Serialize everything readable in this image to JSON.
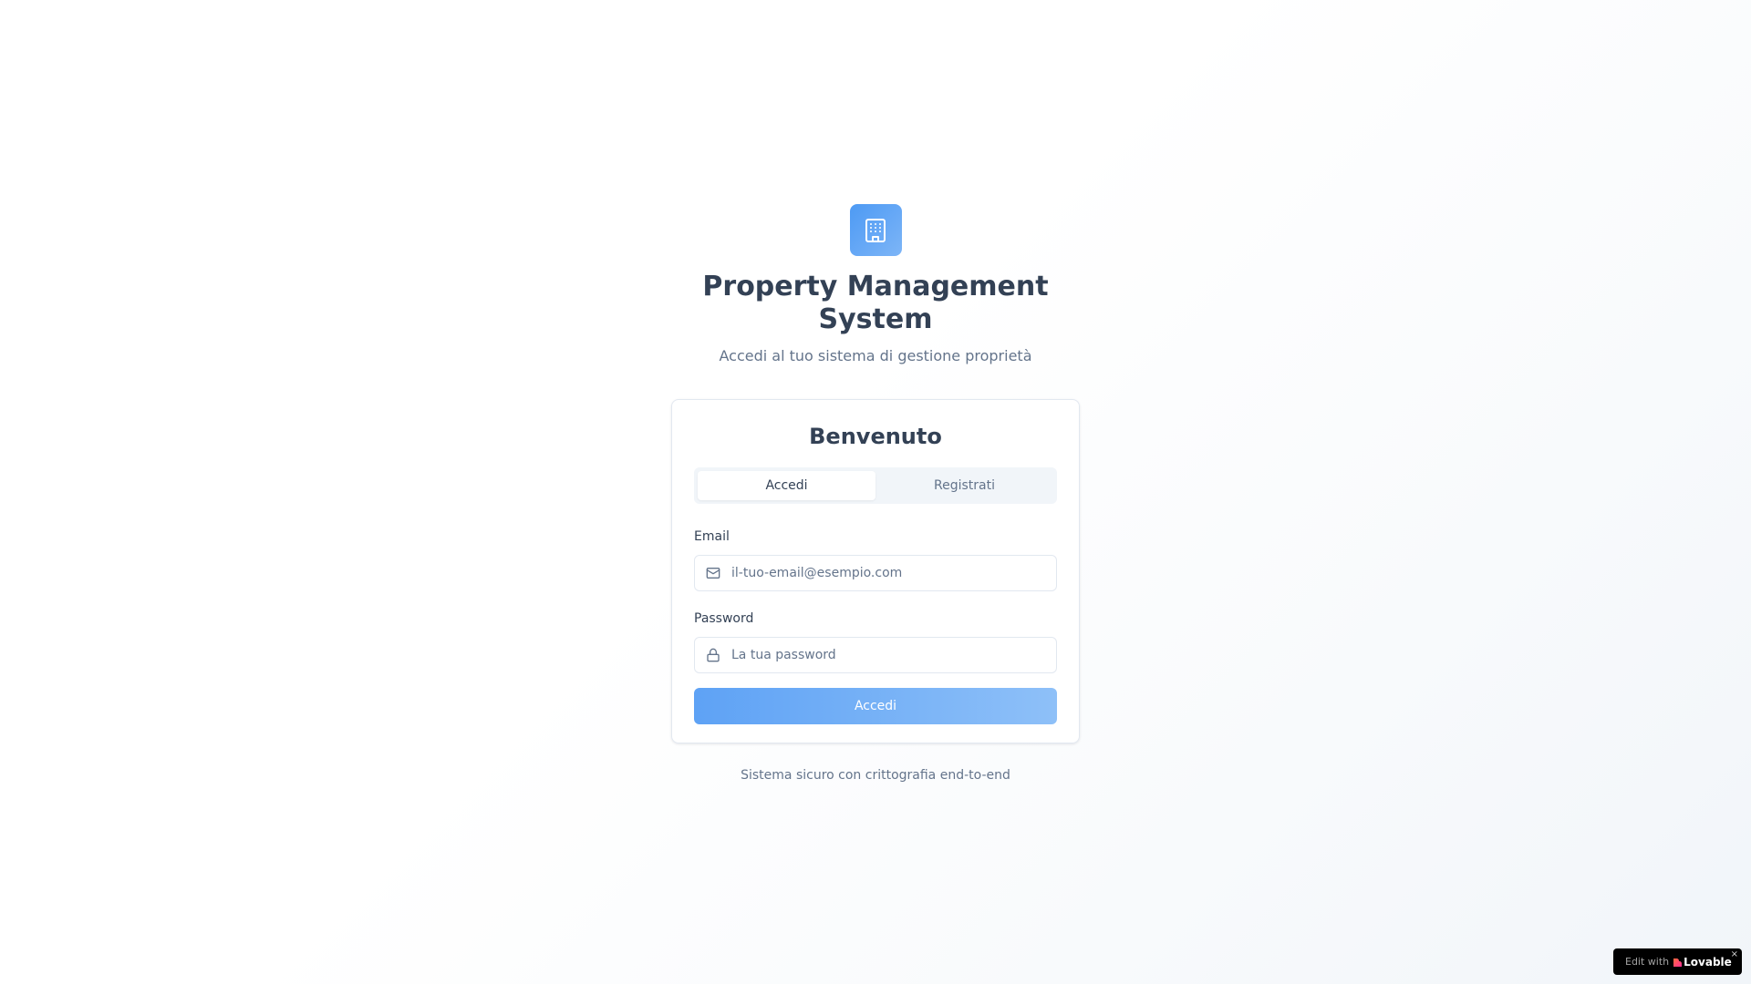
{
  "branding": {
    "icon": "building-icon",
    "title": "Property Management System",
    "subtitle": "Accedi al tuo sistema di gestione proprietà"
  },
  "card": {
    "title": "Benvenuto",
    "tabs": [
      {
        "label": "Accedi",
        "active": true
      },
      {
        "label": "Registrati",
        "active": false
      }
    ],
    "email": {
      "label": "Email",
      "icon": "mail-icon",
      "value": "",
      "placeholder": "il-tuo-email@esempio.com"
    },
    "password": {
      "label": "Password",
      "icon": "lock-icon",
      "value": "",
      "placeholder": "La tua password"
    },
    "submit_label": "Accedi"
  },
  "footer_note": "Sistema sicuro con crittografia end-to-end",
  "badge": {
    "prefix": "Edit with",
    "brand": "Lovable",
    "close": "×"
  },
  "colors": {
    "accent": "#5ea2f5",
    "text_primary": "#334155",
    "text_muted": "#64748b"
  }
}
